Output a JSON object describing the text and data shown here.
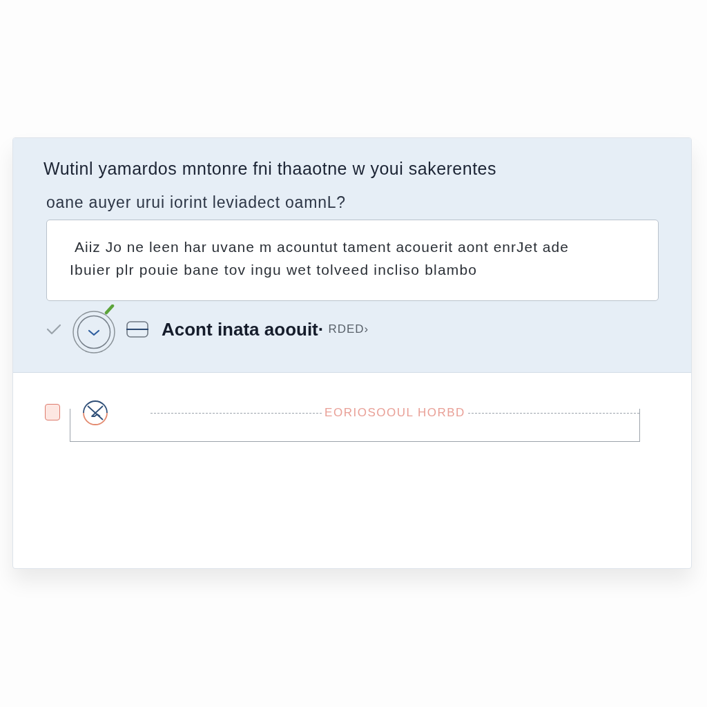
{
  "question": {
    "lines": [
      "Wutinl yamardos mntonre fni thaaotne w youi sakerentes",
      "oane auyer urui iorint leviadect oamnL?"
    ]
  },
  "answer": {
    "lines": [
      "Aiiz Jo ne leen har uvane m acountut tament acouerit aont enrJet ade",
      "Ibuier plr pouie bane tov ingu wet tolveed incliso blambo"
    ]
  },
  "status_row": {
    "title": "Acont inata aoouit·",
    "tag": "RDED›"
  },
  "second_item": {
    "checked": false,
    "label": "EORIOSOOUL HORBD"
  }
}
